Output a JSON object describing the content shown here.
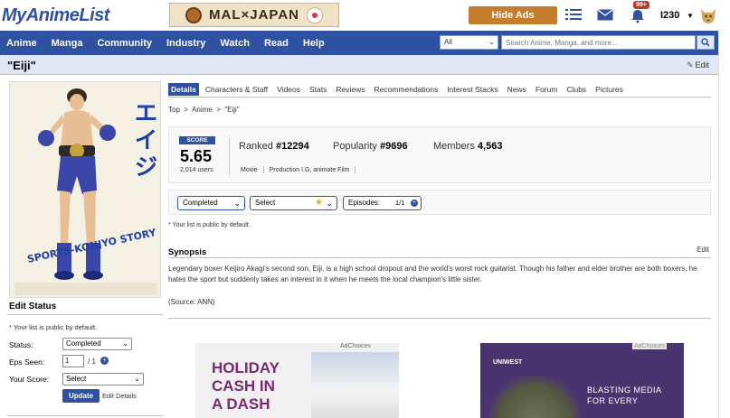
{
  "header": {
    "logo": "MyAnimeList",
    "banner_text": "MAL×JAPAN",
    "hide_ads_label": "Hide Ads",
    "notification_count": "99+",
    "username": "I230"
  },
  "nav": {
    "items": [
      "Anime",
      "Manga",
      "Community",
      "Industry",
      "Watch",
      "Read",
      "Help"
    ],
    "search_scope": "All",
    "search_placeholder": "Search Anime, Manga, and more..."
  },
  "title_bar": {
    "title": "\"Eiji\"",
    "edit_label": "Edit"
  },
  "poster": {
    "title_jp": "エイジ",
    "subtitle": "SPORTS-KONJYO STORY"
  },
  "edit_status": {
    "heading": "Edit Status",
    "note": "* Your list is public by default.",
    "status_label": "Status:",
    "status_value": "Completed",
    "eps_label": "Eps Seen:",
    "eps_value": "1",
    "eps_total": "/ 1",
    "score_label": "Your Score:",
    "score_value": "Select",
    "update_label": "Update",
    "edit_details_label": "Edit Details"
  },
  "tabs": [
    "Details",
    "Characters & Staff",
    "Videos",
    "Stats",
    "Reviews",
    "Recommendations",
    "Interest Stacks",
    "News",
    "Forum",
    "Clubs",
    "Pictures"
  ],
  "breadcrumb": [
    "Top",
    ">",
    "Anime",
    ">",
    "\"Eiji\""
  ],
  "score_box": {
    "label": "SCORE",
    "value": "5.65",
    "users": "2,014 users",
    "ranked_label": "Ranked",
    "ranked_value": "#12294",
    "popularity_label": "Popularity",
    "popularity_value": "#9696",
    "members_label": "Members",
    "members_value": "4,563",
    "type": "Movie",
    "studios": "Production I.G, animate Film"
  },
  "list_bar": {
    "status": "Completed",
    "score": "Select",
    "episodes_label": "Episodes:",
    "episodes_value": "1/1",
    "note": "* Your list is public by default."
  },
  "synopsis": {
    "heading": "Synopsis",
    "edit_label": "Edit",
    "text": "Legendary boxer Keijiro Akagi's second son, Eiji, is a high school dropout and the world's worst rock guitarist. Though his father and elder brother are both boxers, he hates the sport but suddenly takes an interest in it when he meets the local champion's little sister.",
    "source": "(Source: ANN)"
  },
  "ads": {
    "left_choices": "AdChoices",
    "left_line1": "HOLIDAY",
    "left_line2": "CASH IN",
    "left_line3": "A DASH",
    "right_choices": "AdChoices",
    "right_brand": "UNIWEST",
    "right_line1": "BLASTING MEDIA",
    "right_line2": "FOR EVERY"
  },
  "colors": {
    "brand_blue": "#2e51a2",
    "hide_ads": "#c57e2e",
    "title_bar_bg": "#e1e7f5"
  }
}
